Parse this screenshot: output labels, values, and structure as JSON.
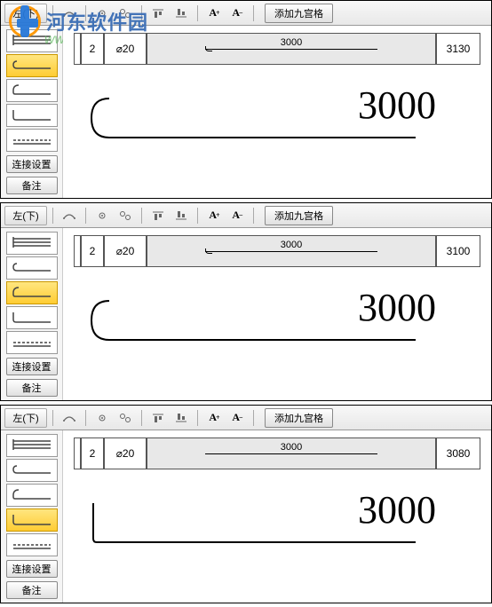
{
  "watermark": {
    "site": "河东软件园",
    "url": "www.pc0359.cn"
  },
  "panels": [
    {
      "label": "左(下)",
      "addGrid": "添加九宫格",
      "sidebar": {
        "connect": "连接设置",
        "note": "备注",
        "selected": 1,
        "shapes": [
          "multi-line",
          "hook-u",
          "hook-single",
          "hook-down",
          "dashed"
        ]
      },
      "spec": {
        "count": "2",
        "diameter": "⌀20",
        "mainLen": "3000",
        "total": "3130",
        "hookLeft": true
      },
      "bigNumber": "3000",
      "hookLeft": true
    },
    {
      "label": "左(下)",
      "addGrid": "添加九宫格",
      "sidebar": {
        "connect": "连接设置",
        "note": "备注",
        "selected": 2,
        "shapes": [
          "multi-line",
          "hook-u",
          "hook-single",
          "hook-down",
          "dashed"
        ]
      },
      "spec": {
        "count": "2",
        "diameter": "⌀20",
        "mainLen": "3000",
        "total": "3100",
        "hookLeft": true
      },
      "bigNumber": "3000",
      "hookLeft": true
    },
    {
      "label": "左(下)",
      "addGrid": "添加九宫格",
      "sidebar": {
        "connect": "连接设置",
        "note": "备注",
        "selected": 3,
        "shapes": [
          "multi-line",
          "hook-u",
          "hook-single",
          "hook-down",
          "dashed"
        ]
      },
      "spec": {
        "count": "2",
        "diameter": "⌀20",
        "mainLen": "3000",
        "total": "3080",
        "hookLeft": false
      },
      "bigNumber": "3000",
      "hookLeft": false
    }
  ],
  "icons": {
    "arc": "arc",
    "gear1": "gear",
    "gear2": "gears",
    "align1": "top",
    "align2": "bottom",
    "fontPlus": "A+",
    "fontMinus": "A-"
  }
}
